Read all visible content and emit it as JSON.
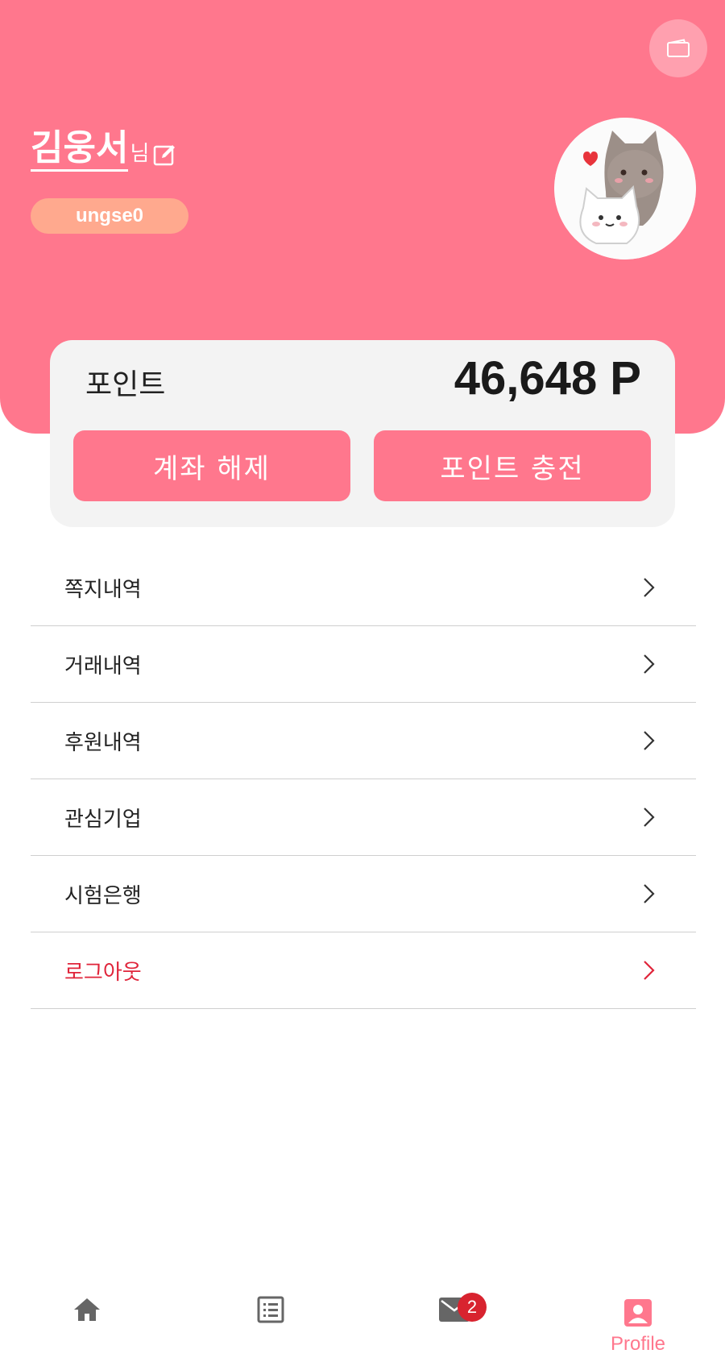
{
  "header": {
    "user_name": "김웅서",
    "honorific": "님",
    "user_id": "ungse0",
    "icons": {
      "wallet": "wallet-icon",
      "edit": "edit-icon",
      "avatar": "cat-avatar-image"
    },
    "bg_color": "#FF778D"
  },
  "points": {
    "label": "포인트",
    "value": "46,648 P",
    "buttons": {
      "unlink": "계좌 해제",
      "charge": "포인트 충전"
    }
  },
  "menu": {
    "items": [
      {
        "label": "쪽지내역"
      },
      {
        "label": "거래내역"
      },
      {
        "label": "후원내역"
      },
      {
        "label": "관심기업"
      },
      {
        "label": "시험은행"
      },
      {
        "label": "로그아웃",
        "color": "#E0243A"
      }
    ]
  },
  "bottom_nav": {
    "items": [
      {
        "icon": "home-icon"
      },
      {
        "icon": "list-icon"
      },
      {
        "icon": "mail-icon",
        "badge": "2"
      },
      {
        "icon": "profile-icon",
        "label": "Profile",
        "active": true
      }
    ],
    "active_color": "#FF778D"
  }
}
